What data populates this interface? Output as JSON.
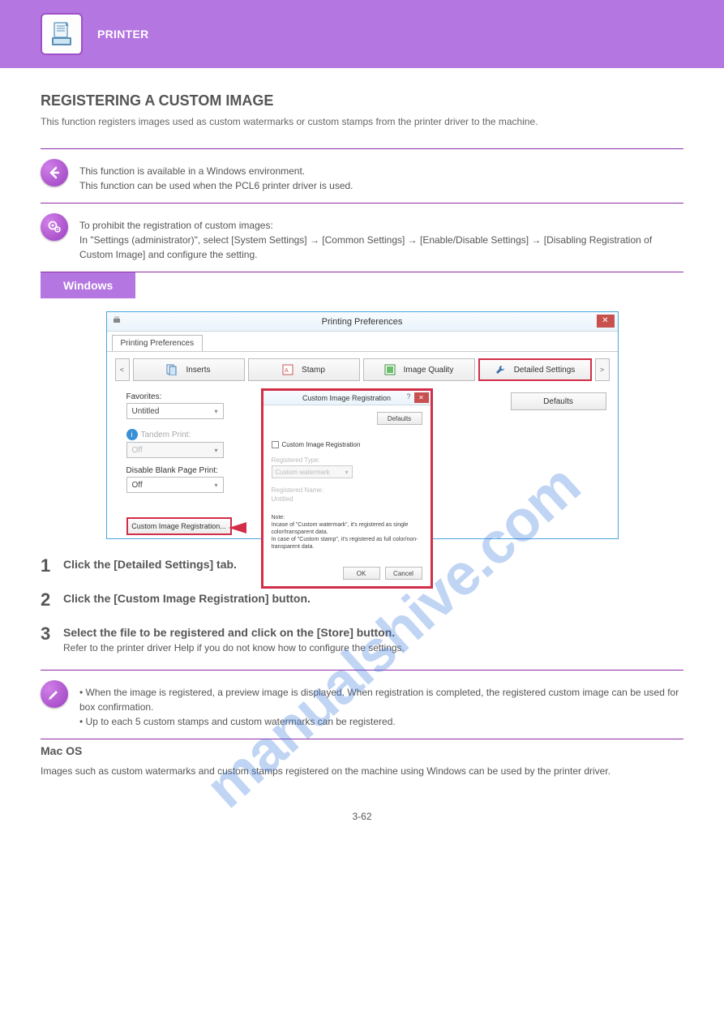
{
  "header": {
    "section": "PRINTER"
  },
  "page": {
    "title": "REGISTERING A CUSTOM IMAGE",
    "desc": "This function registers images used as custom watermarks or custom stamps from the printer driver to the machine."
  },
  "callout_note": "This function is available in a Windows environment.\nThis function can be used when the PCL6 printer driver is used.",
  "callout_settings": "To prohibit the registration of custom images:\nIn \"Settings (administrator)\", select [System Settings] → [Common Settings] → [Enable/Disable Settings] → [Disabling Registration of Custom Image] and configure the setting.",
  "windows": {
    "label": "Windows",
    "pp_title": "Printing Preferences",
    "pp_tab_label": "Printing Preferences",
    "tabs": {
      "inserts": "Inserts",
      "stamp": "Stamp",
      "image_quality": "Image Quality",
      "detailed": "Detailed Settings"
    },
    "body": {
      "favorites_lbl": "Favorites:",
      "favorites_val": "Untitled",
      "tandem_lbl": "Tandem Print:",
      "tandem_val": "Off",
      "disable_lbl": "Disable Blank Page Print:",
      "disable_val": "Off",
      "defaults_btn": "Defaults",
      "cir_btn": "Custom Image Registration..."
    },
    "dlg": {
      "title": "Custom Image Registration",
      "defaults": "Defaults",
      "chk": "Custom Image Registration",
      "regtype_lbl": "Registered Type:",
      "regtype_val": "Custom watermark",
      "regname_lbl": "Registered Name:",
      "regname_val": "Untitled",
      "note_lbl": "Note:",
      "note_body": "Incase of \"Custom watermark\", it's registered as single color/transparent data.\nIn case of \"Custom stamp\", it's registered as full color/non-transparent data.",
      "ok": "OK",
      "cancel": "Cancel"
    },
    "steps": {
      "step1_title": "Click the [Detailed Settings] tab.",
      "step2_title": "Click the [Custom Image Registration] button.",
      "step3_title": "Select the file to be registered and click on the [Store] button.",
      "step3_body": "Refer to the printer driver Help if you do not know how to configure the settings."
    },
    "foot_note": "• When the image is registered, a preview image is displayed. When registration is completed, the registered custom image can be used for box confirmation.\n• Up to each 5 custom stamps and custom watermarks can be registered."
  },
  "mac": {
    "label": "Mac OS",
    "desc": "Images such as custom watermarks and custom stamps registered on the machine using Windows can be used by the printer driver."
  },
  "page_number": "3-62",
  "watermark_text": "manualshive.com"
}
